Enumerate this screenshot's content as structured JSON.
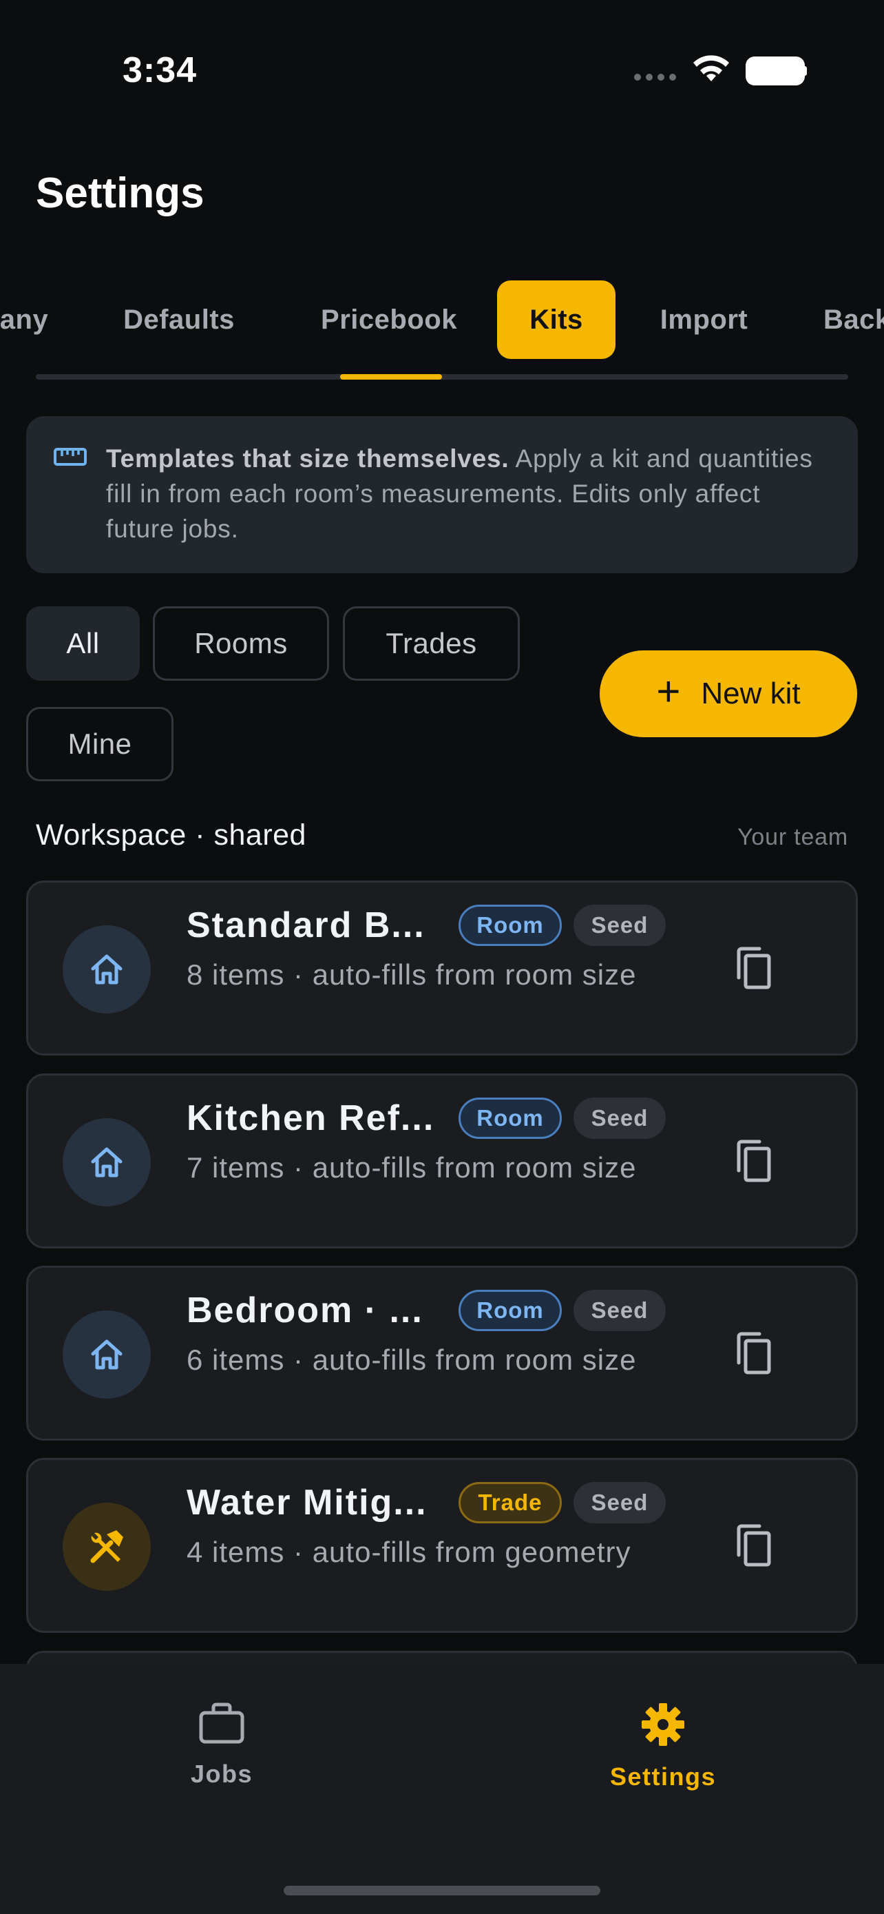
{
  "status_bar": {
    "time": "3:34"
  },
  "header": {
    "title": "Settings"
  },
  "tabs": [
    {
      "label": "any"
    },
    {
      "label": "Defaults"
    },
    {
      "label": "Pricebook"
    },
    {
      "label": "Kits",
      "active": true
    },
    {
      "label": "Import"
    },
    {
      "label": "Back"
    }
  ],
  "banner": {
    "icon": "ruler-icon",
    "bold": "Templates that size themselves.",
    "text": " Apply a kit and quantities fill in from each room’s measurements. Edits only affect future jobs."
  },
  "filters": [
    {
      "label": "All",
      "selected": true
    },
    {
      "label": "Rooms"
    },
    {
      "label": "Trades"
    },
    {
      "label": "Mine"
    }
  ],
  "new_kit": {
    "label": "New kit",
    "icon": "plus-icon"
  },
  "section": {
    "title": "Workspace · shared",
    "meta": "Your team"
  },
  "kits": [
    {
      "title": "Standard B...",
      "badge": "Room",
      "seed": "Seed",
      "subtitle": "8 items · auto-fills from room size",
      "icon": "home-icon"
    },
    {
      "title": "Kitchen Ref...",
      "badge": "Room",
      "seed": "Seed",
      "subtitle": "7 items · auto-fills from room size",
      "icon": "home-icon"
    },
    {
      "title": "Bedroom · ...",
      "badge": "Room",
      "seed": "Seed",
      "subtitle": "6 items · auto-fills from room size",
      "icon": "home-icon"
    },
    {
      "title": "Water Mitig...",
      "badge": "Trade",
      "seed": "Seed",
      "subtitle": "4 items · auto-fills from geometry",
      "icon": "tools-icon"
    }
  ],
  "bottom_nav": [
    {
      "label": "Jobs",
      "icon": "briefcase-icon"
    },
    {
      "label": "Settings",
      "icon": "gear-icon",
      "active": true
    }
  ],
  "colors": {
    "accent": "#f5b700",
    "room_blue": "#7db6f2",
    "background": "#0c0d0f"
  }
}
